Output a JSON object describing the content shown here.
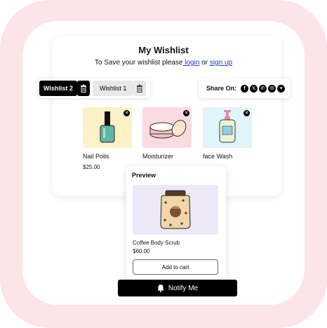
{
  "wishlist": {
    "title": "My Wishlist",
    "subtitle_prefix": "To Save your wishlist please",
    "login": " login",
    "or": " or ",
    "signup": "sign up"
  },
  "tabs": [
    {
      "label": "Wishlist 2"
    },
    {
      "label": "Wishlist 1"
    }
  ],
  "share": {
    "label": "Share On:",
    "icons": [
      "facebook-icon",
      "x-icon",
      "whatsapp-icon",
      "email-icon",
      "messenger-icon"
    ]
  },
  "products": [
    {
      "name": "Nail Polis",
      "price": "$25.00"
    },
    {
      "name": "Moisturizer",
      "price": ""
    },
    {
      "name": "face Wash",
      "price": ""
    }
  ],
  "preview": {
    "title": "Preview",
    "name": "Coffee Body Scrub",
    "price": "$60.00",
    "add_to_cart": "Add to cart"
  },
  "notify": {
    "label": "Notify Me"
  },
  "colors": {
    "background_pink": "#fce4e8",
    "link_blue": "#1a3cc7",
    "thumb_yellow": "#fdf1c7",
    "thumb_pink": "#fadbe0",
    "thumb_blue": "#dff5fa",
    "preview_lavender": "#ede8f7"
  }
}
